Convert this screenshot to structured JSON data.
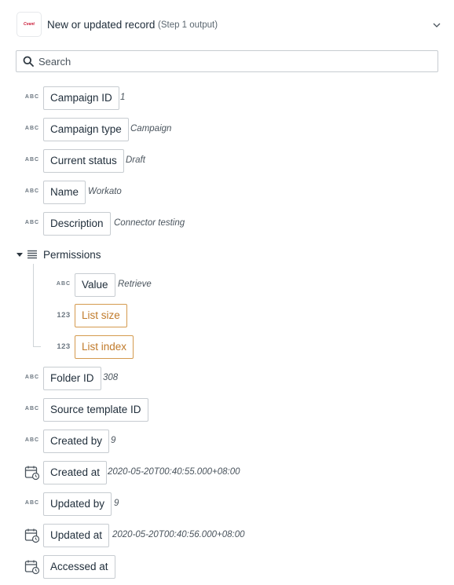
{
  "header": {
    "logo_text": "Cvent",
    "title": "New or updated record",
    "subtitle": "(Step 1 output)"
  },
  "search": {
    "placeholder": "Search"
  },
  "fields_top": [
    {
      "type": "ABC",
      "label": "Campaign ID",
      "sample": "1"
    },
    {
      "type": "ABC",
      "label": "Campaign type",
      "sample": "Campaign"
    },
    {
      "type": "ABC",
      "label": "Current status",
      "sample": "Draft"
    },
    {
      "type": "ABC",
      "label": "Name",
      "sample": "Workato"
    },
    {
      "type": "ABC",
      "label": "Description",
      "sample": "Connector testing"
    }
  ],
  "permissions": {
    "label": "Permissions",
    "children": [
      {
        "type": "ABC",
        "label": "Value",
        "sample": "Retrieve"
      },
      {
        "type": "123",
        "label": "List size",
        "sample": ""
      },
      {
        "type": "123",
        "label": "List index",
        "sample": ""
      }
    ]
  },
  "fields_bottom": [
    {
      "type": "ABC",
      "label": "Folder ID",
      "sample": "308"
    },
    {
      "type": "ABC",
      "label": "Source template ID",
      "sample": ""
    },
    {
      "type": "ABC",
      "label": "Created by",
      "sample": "9"
    },
    {
      "type": "calendar-icon",
      "label": "Created at",
      "sample": "2020-05-20T00:40:55.000+08:00"
    },
    {
      "type": "ABC",
      "label": "Updated by",
      "sample": "9"
    },
    {
      "type": "calendar-icon",
      "label": "Updated at",
      "sample": "2020-05-20T00:40:56.000+08:00"
    },
    {
      "type": "calendar-icon",
      "label": "Accessed at",
      "sample": ""
    }
  ],
  "colors": {
    "accent_orange": "#c07a2a",
    "border": "#c7ccd1",
    "text": "#1f2d3a"
  }
}
